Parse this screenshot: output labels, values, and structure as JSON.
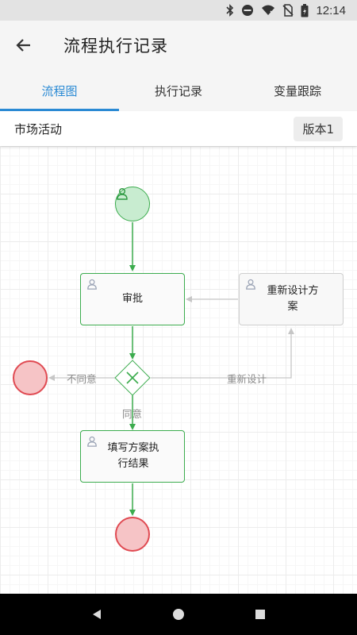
{
  "status_bar": {
    "time": "12:14"
  },
  "app_bar": {
    "title": "流程执行记录"
  },
  "tabs": [
    {
      "label": "流程图",
      "active": true
    },
    {
      "label": "执行记录",
      "active": false
    },
    {
      "label": "变量跟踪",
      "active": false
    }
  ],
  "subheader": {
    "process_name": "市场活动",
    "version_label": "版本1"
  },
  "flow": {
    "nodes": {
      "approve": "审批",
      "redesign": "重新设计方案",
      "fill_result": "填写方案执行结果"
    },
    "edge_labels": {
      "disagree": "不同意",
      "redesign": "重新设计",
      "agree": "同意"
    }
  },
  "colors": {
    "accent": "#2a8ad4",
    "flow_green": "#3cac4e",
    "end_red": "#e04a52"
  }
}
